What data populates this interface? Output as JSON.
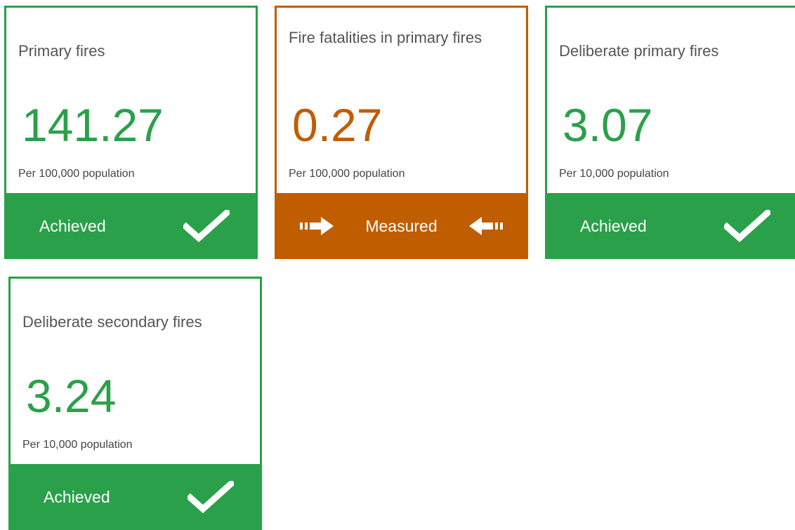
{
  "colors": {
    "achieved": "#2aa04a",
    "measured": "#c05d00"
  },
  "cards": [
    {
      "title": "Primary fires",
      "value": "141.27",
      "unit": "Per 100,000 population",
      "status": "Achieved",
      "status_icon": "checkmark-icon"
    },
    {
      "title": "Fire fatalities in primary fires",
      "value": "0.27",
      "unit": "Per 100,000 population",
      "status": "Measured",
      "status_icon": "arrows-inward-icon"
    },
    {
      "title": "Deliberate primary fires",
      "value": "3.07",
      "unit": "Per 10,000 population",
      "status": "Achieved",
      "status_icon": "checkmark-icon"
    },
    {
      "title": "Deliberate secondary fires",
      "value": "3.24",
      "unit": "Per 10,000 population",
      "status": "Achieved",
      "status_icon": "checkmark-icon"
    }
  ]
}
